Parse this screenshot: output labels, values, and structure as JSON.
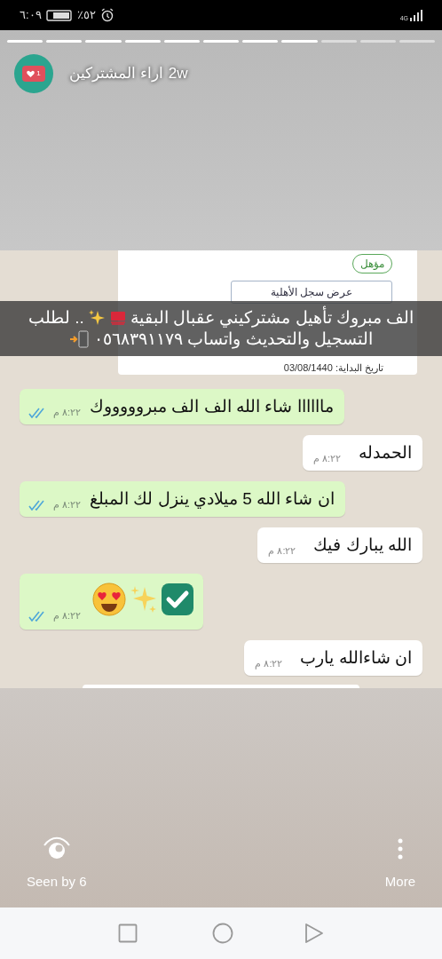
{
  "status_bar": {
    "time": "٦:٠٩",
    "battery": "٪٥٢",
    "network": "4G"
  },
  "story": {
    "progress": [
      {
        "seen": true
      },
      {
        "seen": true
      },
      {
        "seen": true
      },
      {
        "seen": true
      },
      {
        "seen": true
      },
      {
        "seen": true
      },
      {
        "seen": true
      },
      {
        "seen": true
      },
      {
        "seen": false
      },
      {
        "seen": false
      },
      {
        "seen": false
      }
    ],
    "badge_count": "1",
    "username": "اراء المشتركين",
    "age": "2w"
  },
  "screenshot": {
    "card": {
      "status": "مؤهل",
      "button": "عرض سجل الأهلية",
      "start_date": "تاريخ البداية: 03/08/1440"
    },
    "caption": {
      "parts": [
        "الف مبروك تأهيل مشتركيني عقبال البقية",
        ".. لطلب",
        "التسجيل والتحديث واتساب ٠٥٦٨٣٩١١٧٩"
      ]
    },
    "messages": [
      {
        "kind": "sent",
        "text": "ماااااا شاء الله الف الف مبروووووك",
        "time": "٨:٢٢ م"
      },
      {
        "kind": "received",
        "text": "الحمدله",
        "time": "٨:٢٢ م"
      },
      {
        "kind": "sent",
        "text": "ان شاء الله 5 ميلادي ينزل لك المبلغ",
        "time": "٨:٢٢ م"
      },
      {
        "kind": "received",
        "text": "الله يبارك فيك",
        "time": "٨:٢٢ م"
      },
      {
        "kind": "sent_emoji",
        "time": "٨:٢٢ م"
      },
      {
        "kind": "received",
        "text": "ان شاءالله يارب",
        "time": "٨:٢٢ م"
      }
    ]
  },
  "footer": {
    "seen_by": "Seen by 6",
    "more": "More"
  }
}
